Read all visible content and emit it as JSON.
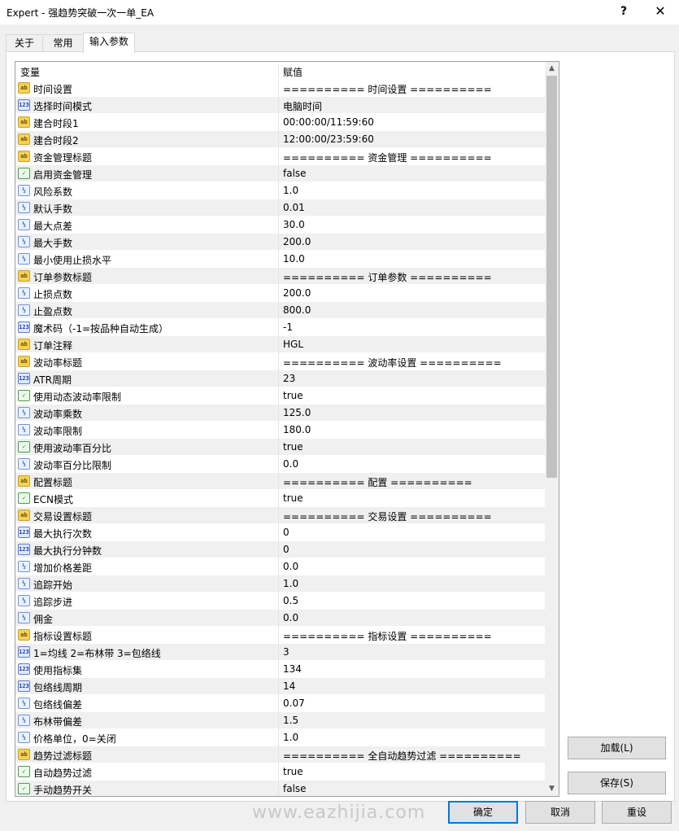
{
  "window": {
    "title": "Expert - 强趋势突破一次一单_EA",
    "help_label": "?",
    "close_label": "✕"
  },
  "tabs": [
    {
      "label": "关于"
    },
    {
      "label": "常用"
    },
    {
      "label": "输入参数"
    }
  ],
  "grid": {
    "col_variable": "变量",
    "col_value": "赋值",
    "rows": [
      {
        "icon": "ab",
        "name": "时间设置",
        "value": "========== 时间设置 =========="
      },
      {
        "icon": "123",
        "name": "选择时间模式",
        "value": "电脑时间"
      },
      {
        "icon": "ab",
        "name": "建合时段1",
        "value": "00:00:00/11:59:60"
      },
      {
        "icon": "ab",
        "name": "建合时段2",
        "value": "12:00:00/23:59:60"
      },
      {
        "icon": "ab",
        "name": "资金管理标题",
        "value": "========== 资金管理 =========="
      },
      {
        "icon": "bool",
        "name": "启用资金管理",
        "value": "false"
      },
      {
        "icon": "half",
        "name": "风险系数",
        "value": "1.0"
      },
      {
        "icon": "half",
        "name": "默认手数",
        "value": "0.01"
      },
      {
        "icon": "half",
        "name": "最大点差",
        "value": "30.0"
      },
      {
        "icon": "half",
        "name": "最大手数",
        "value": "200.0"
      },
      {
        "icon": "half",
        "name": "最小使用止损水平",
        "value": "10.0"
      },
      {
        "icon": "ab",
        "name": "订单参数标题",
        "value": "========== 订单参数 =========="
      },
      {
        "icon": "half",
        "name": "止损点数",
        "value": "200.0"
      },
      {
        "icon": "half",
        "name": "止盈点数",
        "value": "800.0"
      },
      {
        "icon": "123",
        "name": "魔术码（-1=按品种自动生成）",
        "value": "-1"
      },
      {
        "icon": "ab",
        "name": "订单注释",
        "value": "HGL"
      },
      {
        "icon": "ab",
        "name": "波动率标题",
        "value": "========== 波动率设置 =========="
      },
      {
        "icon": "123",
        "name": "ATR周期",
        "value": "23"
      },
      {
        "icon": "bool",
        "name": "使用动态波动率限制",
        "value": "true"
      },
      {
        "icon": "half",
        "name": "波动率乘数",
        "value": "125.0"
      },
      {
        "icon": "half",
        "name": "波动率限制",
        "value": "180.0"
      },
      {
        "icon": "bool",
        "name": "使用波动率百分比",
        "value": "true"
      },
      {
        "icon": "half",
        "name": "波动率百分比限制",
        "value": "0.0"
      },
      {
        "icon": "ab",
        "name": "配置标题",
        "value": "========== 配置 =========="
      },
      {
        "icon": "bool",
        "name": "ECN模式",
        "value": "true"
      },
      {
        "icon": "ab",
        "name": "交易设置标题",
        "value": "========== 交易设置 =========="
      },
      {
        "icon": "123",
        "name": "最大执行次数",
        "value": "0"
      },
      {
        "icon": "123",
        "name": "最大执行分钟数",
        "value": "0"
      },
      {
        "icon": "half",
        "name": "增加价格差距",
        "value": "0.0"
      },
      {
        "icon": "half",
        "name": "追踪开始",
        "value": "1.0"
      },
      {
        "icon": "half",
        "name": "追踪步进",
        "value": "0.5"
      },
      {
        "icon": "half",
        "name": "佣金",
        "value": "0.0"
      },
      {
        "icon": "ab",
        "name": "指标设置标题",
        "value": "========== 指标设置 =========="
      },
      {
        "icon": "123",
        "name": "1=均线 2=布林带 3=包络线",
        "value": "3"
      },
      {
        "icon": "123",
        "name": "使用指标集",
        "value": "134"
      },
      {
        "icon": "123",
        "name": "包络线周期",
        "value": "14"
      },
      {
        "icon": "half",
        "name": "包络线偏差",
        "value": "0.07"
      },
      {
        "icon": "half",
        "name": "布林带偏差",
        "value": "1.5"
      },
      {
        "icon": "half",
        "name": "价格单位，0=关闭",
        "value": "1.0"
      },
      {
        "icon": "ab",
        "name": "趋势过滤标题",
        "value": "========== 全自动趋势过滤 =========="
      },
      {
        "icon": "bool",
        "name": "自动趋势过滤",
        "value": "true"
      },
      {
        "icon": "bool",
        "name": "手动趋势开关",
        "value": "false"
      }
    ]
  },
  "buttons": {
    "load": "加载(L)",
    "save": "保存(S)",
    "ok": "确定",
    "cancel": "取消",
    "reset": "重设"
  },
  "watermark": "www.eazhijia.com"
}
